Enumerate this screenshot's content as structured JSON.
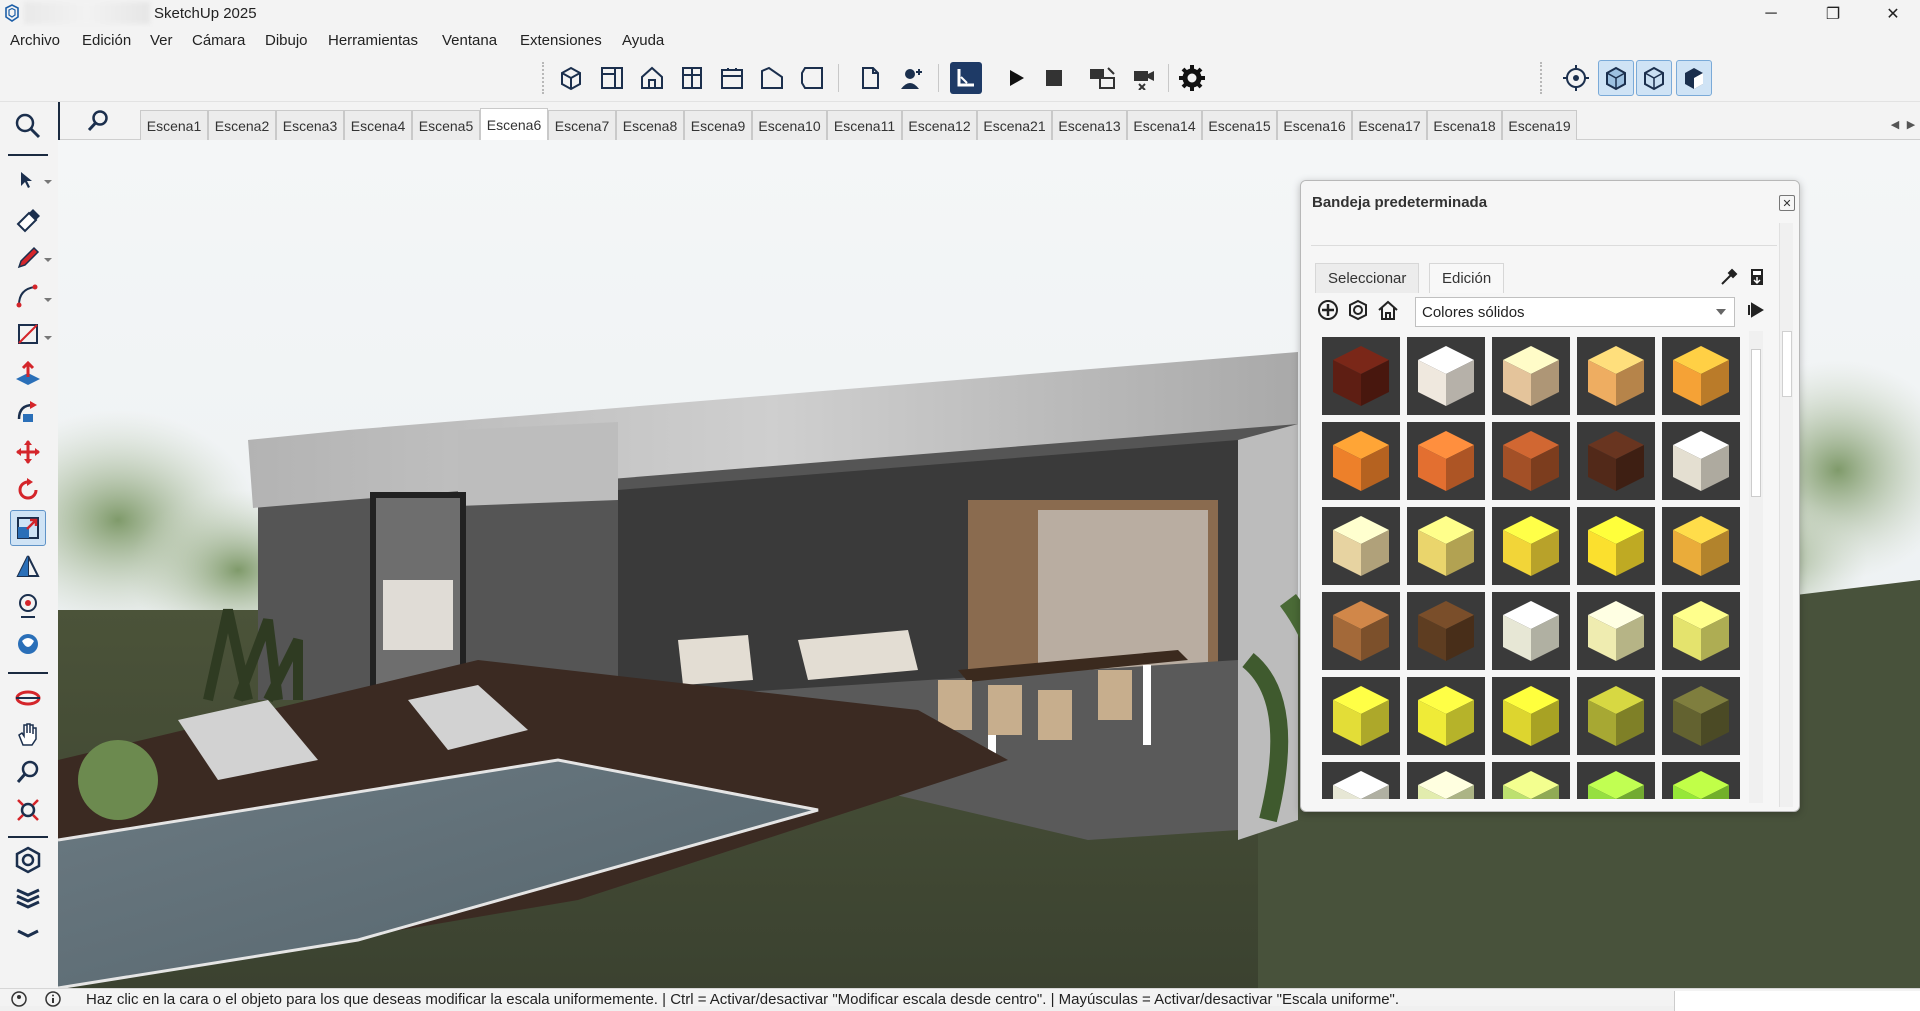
{
  "app": {
    "title": "SketchUp 2025"
  },
  "window_controls": {
    "minimize": "─",
    "restore": "❐",
    "close": "✕"
  },
  "menu": [
    "Archivo",
    "Edición",
    "Ver",
    "Cámara",
    "Dibujo",
    "Herramientas",
    "Ventana",
    "Extensiones",
    "Ayuda"
  ],
  "toolbar_icons": [
    "iso-view-icon",
    "top-view-icon",
    "front-view-icon",
    "right-view-icon",
    "back-view-icon",
    "left-view-icon",
    "bottom-view-icon",
    "new-file-icon",
    "add-user-icon",
    "select-tool-icon",
    "play-icon",
    "stop-icon",
    "scene-thumbnails-icon",
    "camera-off-icon",
    "settings-icon",
    "position-camera-icon",
    "style-xray-icon",
    "style-wireframe-icon",
    "style-shaded-icon"
  ],
  "scenes": {
    "tabs": [
      "Escena1",
      "Escena2",
      "Escena3",
      "Escena4",
      "Escena5",
      "Escena6",
      "Escena7",
      "Escena8",
      "Escena9",
      "Escena10",
      "Escena11",
      "Escena12",
      "Escena21",
      "Escena13",
      "Escena14",
      "Escena15",
      "Escena16",
      "Escena17",
      "Escena18",
      "Escena19"
    ],
    "current": "Escena6",
    "scroll_left": "◀",
    "scroll_right": "▶"
  },
  "left_tools": [
    "zoom-extents-icon",
    "select-icon",
    "eraser-icon",
    "pencil-icon",
    "arc-icon",
    "rectangle-icon",
    "push-pull-icon",
    "follow-me-icon",
    "move-icon",
    "rotate-icon",
    "scale-icon",
    "tape-measure-icon",
    "paint-bucket-icon",
    "tag-icon",
    "section-plane-icon",
    "pan-icon",
    "zoom-icon",
    "zoom-window-icon",
    "components-icon",
    "layers-icon"
  ],
  "tray": {
    "title": "Bandeja predeterminada",
    "close": "✕",
    "tabs": [
      "Seleccionar",
      "Edición"
    ],
    "active_tab": "Seleccionar",
    "library": "Colores sólidos",
    "swatches": [
      "#5a1d12",
      "#e4ddd3",
      "#d9bb94",
      "#e3a55c",
      "#e99a33",
      "#e27a28",
      "#d86a2e",
      "#9b4c25",
      "#4e2718",
      "#d9d4c7",
      "#dcc999",
      "#dfcb67",
      "#e6cb35",
      "#efd52c",
      "#dfa437",
      "#9b6436",
      "#5a3a1f",
      "#dcdccb",
      "#e4e1a8",
      "#d9d868",
      "#d8d234",
      "#e4e034",
      "#d2cb2d",
      "#9fa031",
      "#5e5d2e",
      "#dcdccb",
      "#d7e1a6",
      "#b4d56a",
      "#8fd43d",
      "#8fdc35"
    ]
  },
  "status": {
    "message": "Haz clic en la cara o el objeto para los que deseas modificar la escala uniformemente. | Ctrl = Activar/desactivar \"Modificar escala desde centro\". | Mayúsculas = Activar/desactivar \"Escala uniforme\"."
  }
}
